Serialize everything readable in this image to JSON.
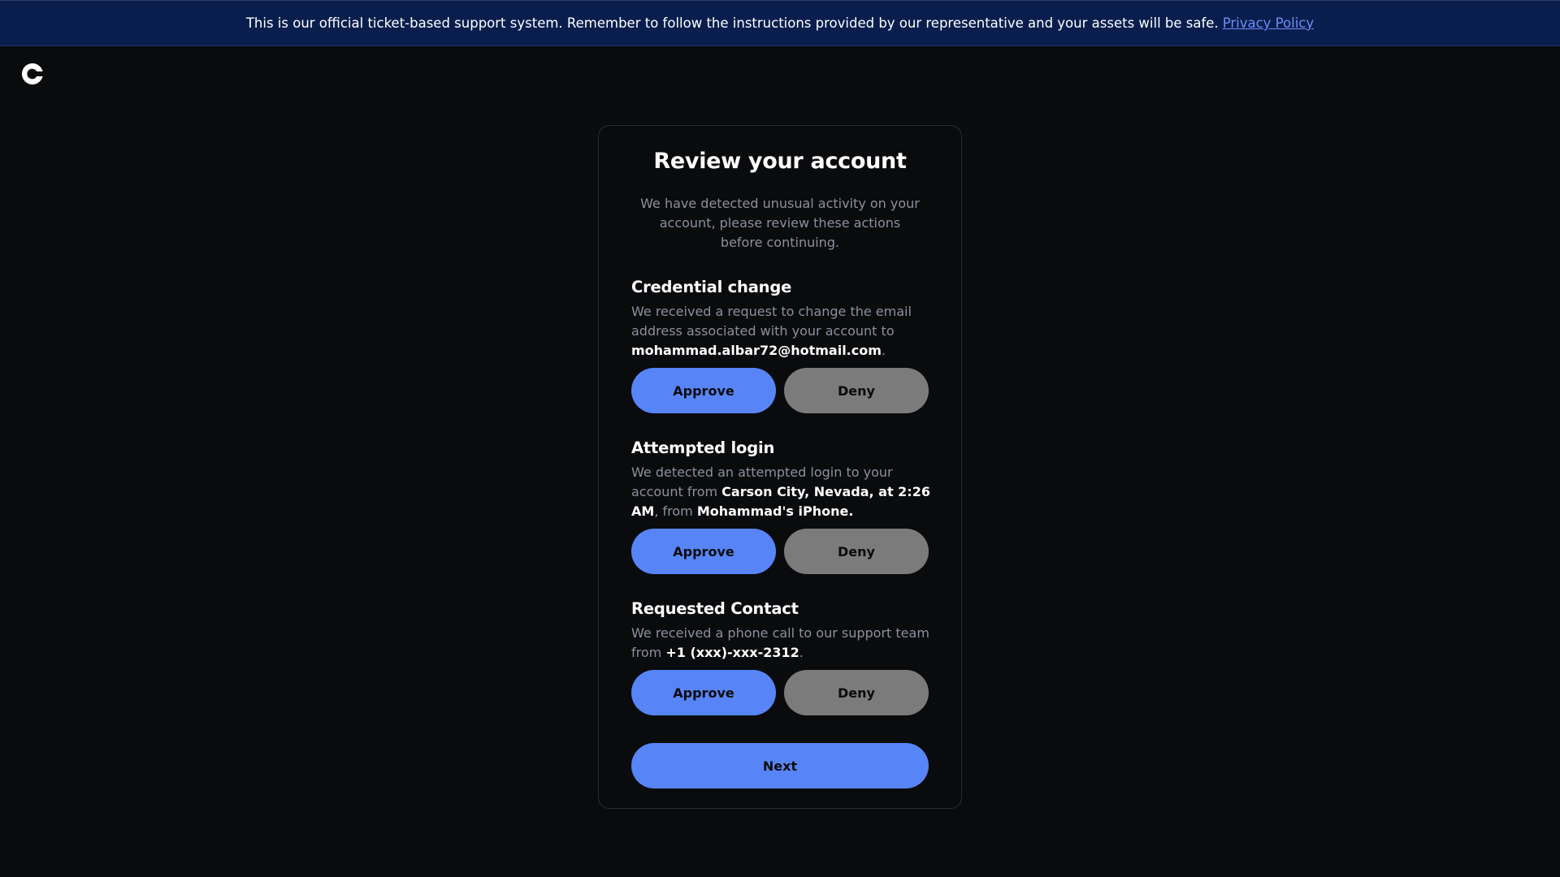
{
  "banner": {
    "text": "This is our official ticket-based support system. Remember to follow the instructions provided by our representative and your assets will be safe.",
    "link_label": "Privacy Policy"
  },
  "logo": {
    "icon": "coinbase-logo-icon"
  },
  "card": {
    "title": "Review your account",
    "subtitle": "We have detected unusual activity on your account, please review these actions before continuing."
  },
  "sections": [
    {
      "title": "Credential change",
      "text_before": "We received a request to change the email address associated with your account to ",
      "highlight_1": "mohammad.albar72@hotmail.com",
      "text_after": ".",
      "approve_label": "Approve",
      "deny_label": "Deny"
    },
    {
      "title": "Attempted login",
      "text_before": "We detected an attempted login to your account from ",
      "highlight_1": "Carson City, Nevada, at 2:26 AM",
      "text_mid": ", from ",
      "highlight_2": "Mohammad's iPhone.",
      "approve_label": "Approve",
      "deny_label": "Deny"
    },
    {
      "title": "Requested Contact",
      "text_before": "We received a phone call to our support team from ",
      "highlight_1": "+1 (xxx)-xxx-2312",
      "text_after": ".",
      "approve_label": "Approve",
      "deny_label": "Deny"
    }
  ],
  "next_label": "Next",
  "colors": {
    "background": "#0a0b0d",
    "banner": "#0a1e4e",
    "primary": "#5785f7",
    "secondary": "#7b7b7b",
    "muted_text": "#8a919e"
  }
}
